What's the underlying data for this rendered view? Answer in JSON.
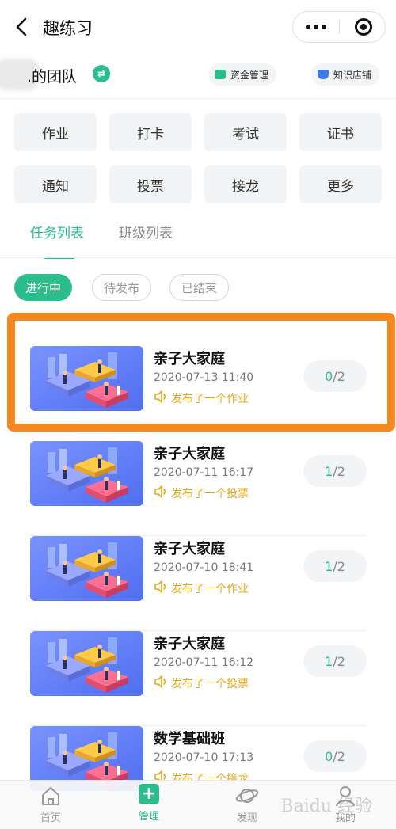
{
  "nav": {
    "title": "趣练习"
  },
  "team": {
    "name": ".的团队",
    "funds_label": "资金管理",
    "shop_label": "知识店铺"
  },
  "grid": [
    "作业",
    "打卡",
    "考试",
    "证书",
    "通知",
    "投票",
    "接龙",
    "更多"
  ],
  "tabs": {
    "active": "任务列表",
    "inactive": "班级列表"
  },
  "filters": [
    "进行中",
    "待发布",
    "已结束"
  ],
  "tasks": [
    {
      "title": "亲子大家庭",
      "date": "2020-07-13 11:40",
      "action": "发布了一个作业",
      "done": "0",
      "total": "/2"
    },
    {
      "title": "亲子大家庭",
      "date": "2020-07-11 16:17",
      "action": "发布了一个投票",
      "done": "1",
      "total": "/2"
    },
    {
      "title": "亲子大家庭",
      "date": "2020-07-10 18:41",
      "action": "发布了一个作业",
      "done": "1",
      "total": "/2"
    },
    {
      "title": "亲子大家庭",
      "date": "2020-07-11 16:12",
      "action": "发布了一个投票",
      "done": "1",
      "total": "/2"
    },
    {
      "title": "数学基础班",
      "date": "2020-07-10 17:13",
      "action": "发布了一个接龙",
      "done": "0",
      "total": "/2"
    }
  ],
  "tabbar": {
    "home": "首页",
    "manage": "管理",
    "discover": "发现",
    "mine": "我的"
  },
  "colors": {
    "accent": "#2bbd8a",
    "highlight": "#f5891f",
    "action": "#e6a817"
  },
  "watermark": "Baidu 经验"
}
